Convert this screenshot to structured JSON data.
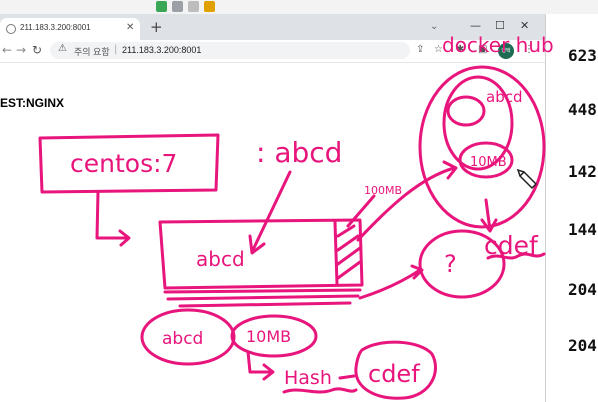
{
  "browser": {
    "tab": {
      "title": "211.183.3.200:8001"
    },
    "new_tab_label": "+",
    "address": {
      "security": "주의 요함",
      "url": "211.183.3.200:8001"
    },
    "profile_label": "영택"
  },
  "page": {
    "heading": "EST:NGINX"
  },
  "side_numbers": [
    "623",
    "448",
    "142",
    "144",
    "204",
    "204"
  ],
  "annotations": {
    "centos": "centos:7",
    "abcd_label": ": abcd",
    "size_label": "100MB",
    "docker_hub": "docker hub",
    "hub_abcd": "abcd",
    "hub_size": "10MB",
    "cdef_right": "cdef",
    "question": "?",
    "layer_text": "abcd",
    "bottom_abcd": "abcd",
    "bottom_size": "10MB",
    "hash_label": "Hash",
    "cdef_bottom": "cdef"
  },
  "colors": {
    "ink": "#e8157c",
    "profile": "#1c6b52"
  }
}
